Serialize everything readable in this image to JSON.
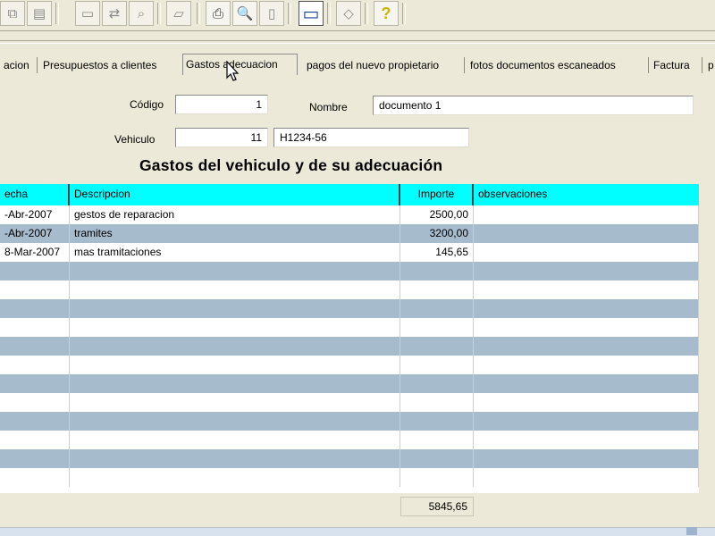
{
  "toolbar": {
    "buttons": [
      {
        "icon": "copy-icon",
        "glyph": "⧉",
        "state": "disabled"
      },
      {
        "icon": "paste-icon",
        "glyph": "▤",
        "state": "disabled"
      },
      {
        "icon": "window-icon",
        "glyph": "▭",
        "state": "disabled"
      },
      {
        "icon": "replace-icon",
        "glyph": "⇄",
        "state": "disabled"
      },
      {
        "icon": "search-icon",
        "glyph": "⌕",
        "state": "disabled"
      },
      {
        "icon": "stamp-icon",
        "glyph": "▱",
        "state": "disabled"
      },
      {
        "icon": "print-icon",
        "glyph": "⎙",
        "state": "active"
      },
      {
        "icon": "print-preview-icon",
        "glyph": "🔍",
        "state": "active"
      },
      {
        "icon": "page-icon",
        "glyph": "▯",
        "state": "disabled"
      },
      {
        "icon": "monitor-icon",
        "glyph": "▭",
        "state": "selected"
      },
      {
        "icon": "eraser-icon",
        "glyph": "◇",
        "state": "disabled"
      },
      {
        "icon": "help-icon",
        "glyph": "?",
        "state": "active"
      }
    ]
  },
  "tabs": [
    {
      "label": "acion",
      "selected": false
    },
    {
      "label": "Presupuestos a clientes",
      "selected": false
    },
    {
      "label": "Gastos adecuacion",
      "selected": true
    },
    {
      "label": "pagos del nuevo propietario",
      "selected": false
    },
    {
      "label": "fotos documentos escaneados",
      "selected": false
    },
    {
      "label": "Factura",
      "selected": false
    },
    {
      "label": "p",
      "selected": false
    }
  ],
  "form": {
    "codigo_label": "Código",
    "codigo_value": "1",
    "nombre_label": "Nombre",
    "nombre_value": "documento 1",
    "vehiculo_label": "Vehiculo",
    "vehiculo_id": "11",
    "vehiculo_plate": "H1234-56"
  },
  "title": "Gastos del vehiculo y de su adecuación",
  "table": {
    "header_color": "#00ffff",
    "stripe_color": "#a6bbcc",
    "columns": [
      "echa",
      "Descripcion",
      "Importe",
      "observaciones"
    ],
    "rows": [
      [
        "-Abr-2007",
        "gestos de reparacion",
        "2500,00",
        ""
      ],
      [
        "-Abr-2007",
        "tramites",
        "3200,00",
        ""
      ],
      [
        "8-Mar-2007",
        "mas tramitaciones",
        "145,65",
        ""
      ],
      [
        "",
        "",
        "",
        ""
      ],
      [
        "",
        "",
        "",
        ""
      ],
      [
        "",
        "",
        "",
        ""
      ],
      [
        "",
        "",
        "",
        ""
      ],
      [
        "",
        "",
        "",
        ""
      ],
      [
        "",
        "",
        "",
        ""
      ],
      [
        "",
        "",
        "",
        ""
      ],
      [
        "",
        "",
        "",
        ""
      ],
      [
        "",
        "",
        "",
        ""
      ],
      [
        "",
        "",
        "",
        ""
      ],
      [
        "",
        "",
        "",
        ""
      ],
      [
        "",
        "",
        "",
        ""
      ]
    ],
    "total": "5845,65"
  }
}
